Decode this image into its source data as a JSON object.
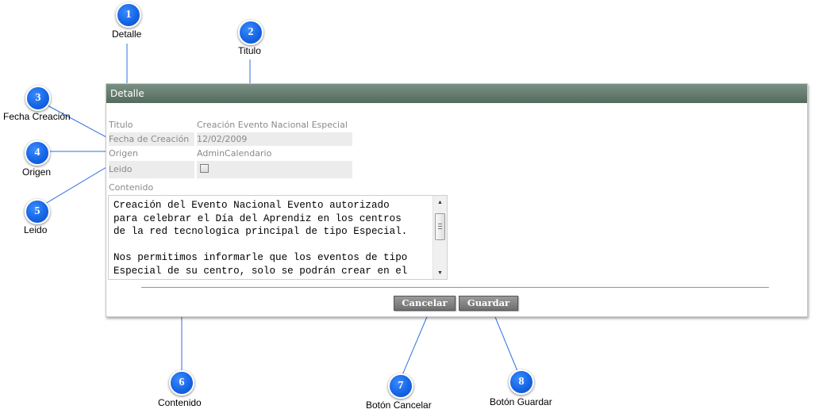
{
  "callouts": [
    {
      "number": "1",
      "label": "Detalle"
    },
    {
      "number": "2",
      "label": "Titulo"
    },
    {
      "number": "3",
      "label": "Fecha Creación"
    },
    {
      "number": "4",
      "label": "Origen"
    },
    {
      "number": "5",
      "label": "Leido"
    },
    {
      "number": "6",
      "label": "Contenido"
    },
    {
      "number": "7",
      "label": "Botón Cancelar"
    },
    {
      "number": "8",
      "label": "Botón Guardar"
    }
  ],
  "panel": {
    "title": "Detalle",
    "fields": {
      "titulo": {
        "label": "Titulo",
        "value": "Creación Evento Nacional Especial"
      },
      "fecha_creacion": {
        "label": "Fecha de Creación",
        "value": "12/02/2009"
      },
      "origen": {
        "label": "Origen",
        "value": "AdminCalendario"
      },
      "leido": {
        "label": "Leido",
        "checked": false
      }
    },
    "contenido": {
      "label": "Contenido",
      "text": "Creación del Evento Nacional Evento autorizado\npara celebrar el Día del Aprendiz en los centros\nde la red tecnologica principal de tipo Especial.\n\nNos permitimos informarle que los eventos de tipo\nEspecial de su centro, solo se podrán crear en el"
    },
    "buttons": {
      "cancel": "Cancelar",
      "save": "Guardar"
    }
  },
  "colors": {
    "callout_blue": "#1565e6",
    "header_green": "#617a6c",
    "button_gray": "#808080"
  },
  "icons": {
    "scroll_up": "triangle-up",
    "scroll_down": "triangle-down"
  }
}
